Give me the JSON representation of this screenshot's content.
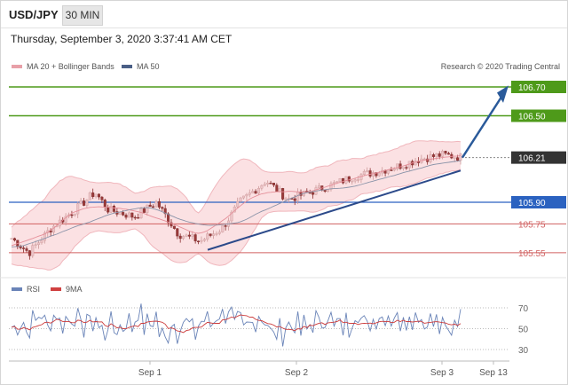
{
  "header": {
    "symbol": "USD/JPY",
    "timeframe": "30 MIN"
  },
  "timestamp": "Thursday, September 3, 2020 3:37:41 AM CET",
  "legend": {
    "ma20": "MA 20 + Bollinger Bands",
    "ma50": "MA 50",
    "credit": "Research © 2020 Trading Central"
  },
  "rsi_legend": {
    "rsi": "RSI",
    "ma9": "9MA"
  },
  "colors": {
    "ma20": "#e8a0a8",
    "ma50": "#4a5f86",
    "candle_up": "#ecc4c8",
    "candle_down": "#9a3a3a",
    "green": "#4e9a1a",
    "blue": "#2b62c0",
    "red": "#d06060",
    "arrow": "#2a5a9a"
  },
  "chart_data": [
    {
      "type": "candlestick",
      "y_range": [
        105.42,
        106.78
      ],
      "x_tick_labels": [
        "Sep 1",
        "Sep 2",
        "Sep 3",
        "Sep 13"
      ],
      "price_levels": [
        {
          "label": "106.70",
          "value": 106.7,
          "kind": "resistance"
        },
        {
          "label": "106.50",
          "value": 106.5,
          "kind": "resistance"
        },
        {
          "label": "106.21",
          "value": 106.21,
          "kind": "last"
        },
        {
          "label": "105.90",
          "value": 105.9,
          "kind": "pivot"
        },
        {
          "label": "105.75",
          "value": 105.75,
          "kind": "support"
        },
        {
          "label": "105.55",
          "value": 105.55,
          "kind": "support"
        }
      ],
      "series": [
        {
          "name": "MA 20 + Bollinger Bands"
        },
        {
          "name": "MA 50"
        }
      ]
    },
    {
      "type": "line",
      "y_ticks": [
        "70",
        "50",
        "30"
      ],
      "series": [
        {
          "name": "RSI"
        },
        {
          "name": "9MA"
        }
      ]
    }
  ]
}
